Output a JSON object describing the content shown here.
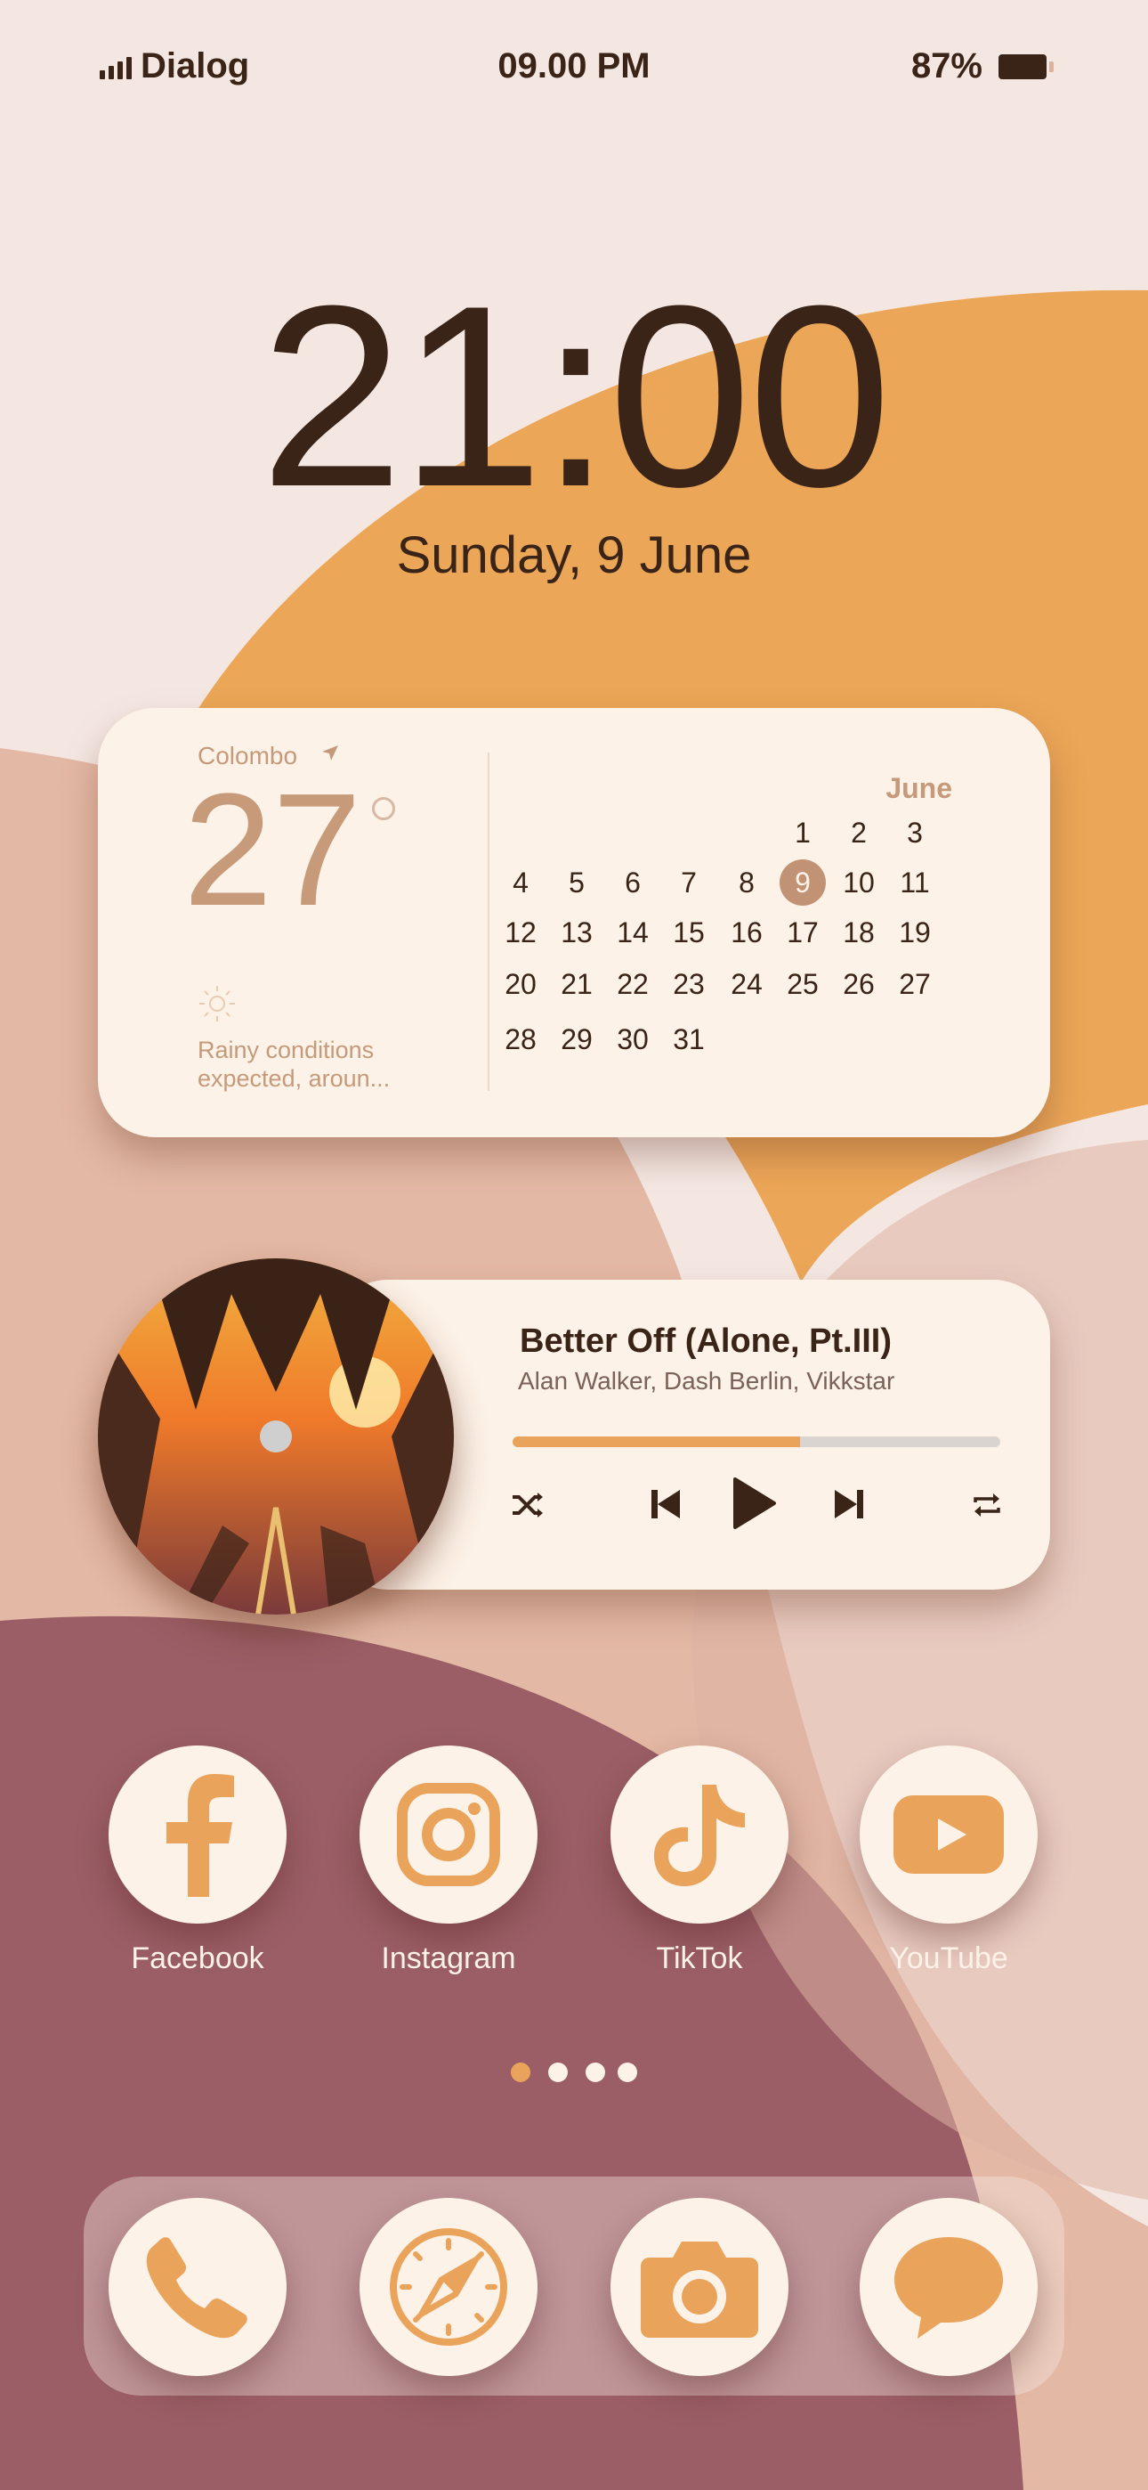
{
  "status_bar": {
    "carrier": "Dialog",
    "time": "09.00 PM",
    "battery": "87%",
    "battery_level": 0.87
  },
  "lock": {
    "clock": "21:00",
    "date": "Sunday, 9 June"
  },
  "weather": {
    "city": "Colombo",
    "temperature": "27",
    "forecast": "Rainy conditions expected, aroun..."
  },
  "calendar": {
    "month": "June",
    "today": "9",
    "rows": [
      [
        "",
        "",
        "",
        "",
        "1",
        "2",
        "3"
      ],
      [
        "4",
        "5",
        "6",
        "7",
        "8",
        "9",
        "10",
        "11"
      ],
      [
        "12",
        "13",
        "14",
        "15",
        "16",
        "17",
        "18",
        "19"
      ],
      [
        "20",
        "21",
        "22",
        "23",
        "24",
        "25",
        "26",
        "27"
      ],
      [
        "28",
        "29",
        "30",
        "31"
      ]
    ]
  },
  "music": {
    "title": "Better Off (Alone, Pt.III)",
    "artist": "Alan Walker, Dash Berlin, Vikkstar",
    "progress": 0.59,
    "controls": [
      "shuffle-icon",
      "previous-icon",
      "play-icon",
      "next-icon",
      "repeat-icon"
    ]
  },
  "apps": [
    {
      "label": "Facebook",
      "icon": "facebook-icon"
    },
    {
      "label": "Instagram",
      "icon": "instagram-icon"
    },
    {
      "label": "TikTok",
      "icon": "tiktok-icon"
    },
    {
      "label": "YouTube",
      "icon": "youtube-icon"
    }
  ],
  "page_indicator": {
    "count": 4,
    "active": 0
  },
  "dock": [
    "phone-icon",
    "safari-icon",
    "camera-icon",
    "messages-icon"
  ],
  "colors": {
    "accent": "#eaa35a",
    "text": "#3a2418",
    "card": "#fdf2e7",
    "wine": "#9b5e66"
  }
}
